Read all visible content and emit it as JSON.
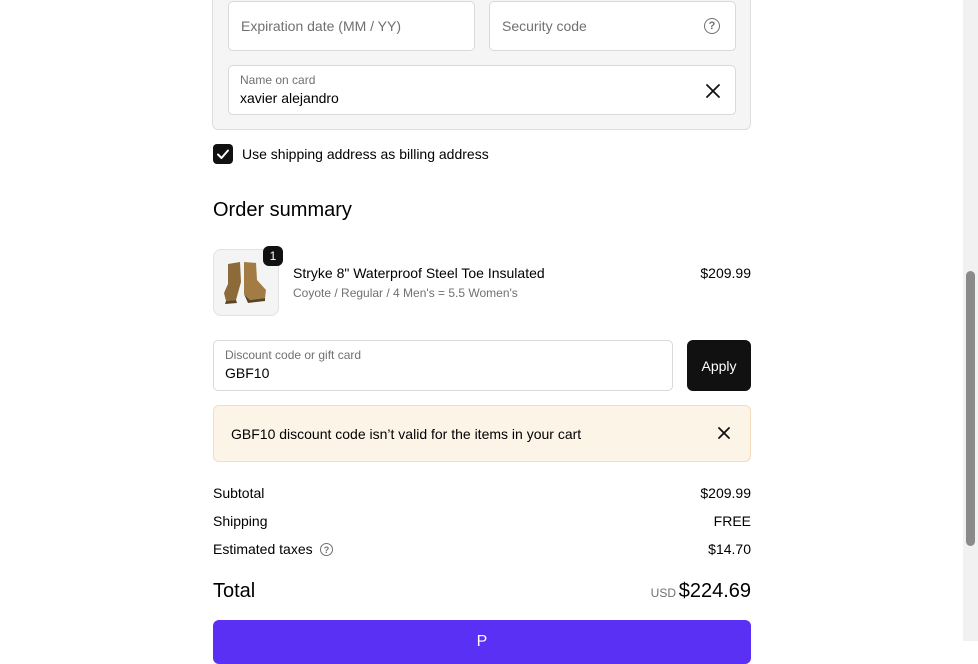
{
  "payment": {
    "expiration_placeholder": "Expiration date (MM / YY)",
    "security_placeholder": "Security code",
    "name_label": "Name on card",
    "name_value": "xavier alejandro"
  },
  "billing": {
    "checkbox_checked": true,
    "checkbox_label": "Use shipping address as billing address"
  },
  "order_summary": {
    "title": "Order summary",
    "item": {
      "quantity": "1",
      "name": "Stryke 8\" Waterproof Steel Toe Insulated",
      "variant": "Coyote / Regular / 4 Men's = 5.5 Women's",
      "price": "$209.99"
    },
    "discount": {
      "label": "Discount code or gift card",
      "value": "GBF10",
      "apply_label": "Apply"
    },
    "error_message": "GBF10 discount code isn’t valid for the items in your cart",
    "subtotal_label": "Subtotal",
    "subtotal_value": "$209.99",
    "shipping_label": "Shipping",
    "shipping_value": "FREE",
    "taxes_label": "Estimated taxes",
    "taxes_value": "$14.70",
    "total_label": "Total",
    "currency": "USD",
    "total_value": "$224.69"
  },
  "pay_button_label": "P",
  "colors": {
    "pay_button": "#5a31f4",
    "banner_bg": "#fdf4e8",
    "dark": "#111111"
  }
}
